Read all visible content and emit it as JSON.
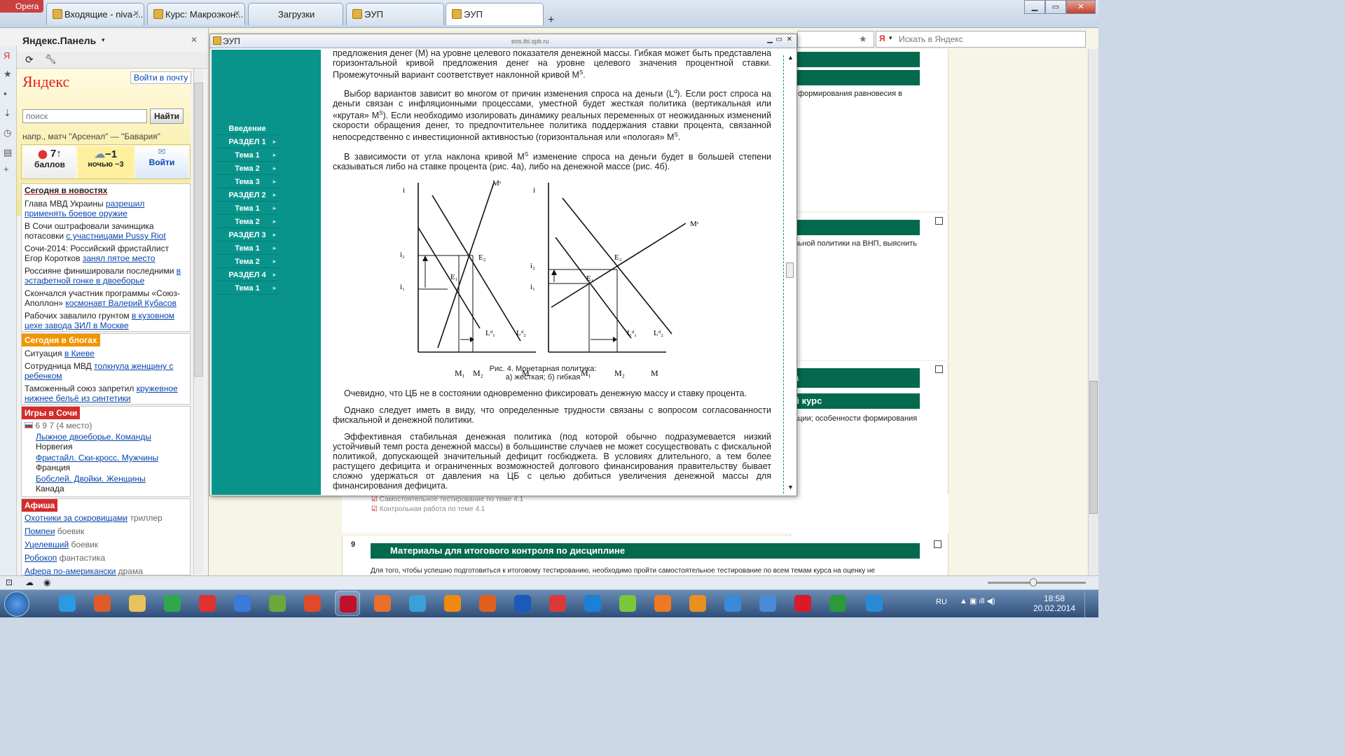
{
  "browser": {
    "app_name": "Opera",
    "tabs": [
      {
        "label": "Входящие - niva-..."
      },
      {
        "label": "Курс: Макроэкон..."
      },
      {
        "label": "Загрузки"
      },
      {
        "label": "ЭУП"
      },
      {
        "label": "ЭУП"
      }
    ],
    "new_tab": "+",
    "search_placeholder": "Искать в Яндекс"
  },
  "yandex_panel": {
    "title": "Яндекс.Панель",
    "logo": "Яндекс",
    "login": "Войти в почту",
    "search_placeholder": "поиск",
    "search_button": "Найти",
    "suggest": "напр., матч \"Арсенал\" — \"Бавария\"",
    "widgets": {
      "traffic_value": "7",
      "traffic_label": "баллов",
      "weather_value": "−1",
      "weather_label": "ночью −3",
      "mail_label": "Войти"
    },
    "news_title": "Сегодня в новостях",
    "news": [
      {
        "pre": "Глава МВД Украины ",
        "link": "разрешил применять боевое оружие"
      },
      {
        "pre": "В Сочи оштрафовали зачинщика потасовки ",
        "link": "с участницами Pussy Riot"
      },
      {
        "pre": "Сочи-2014: Российский фристайлист Егор Коротков ",
        "link": "занял пятое место"
      },
      {
        "pre": "Россияне финишировали последними ",
        "link": "в эстафетной гонке в двоеборье"
      },
      {
        "pre": "Скончался участник программы «Союз-Аполлон» ",
        "link": "космонавт Валерий Кубасов"
      },
      {
        "pre": "Рабочих завалило грунтом ",
        "link": "в кузовном цехе завода ЗИЛ в Москве"
      }
    ],
    "blogs_title": "Сегодня в блогах",
    "blogs": [
      {
        "pre": "Ситуация ",
        "link": "в Киеве"
      },
      {
        "pre": "Сотрудница МВД ",
        "link": "толкнула женщину с ребенком"
      },
      {
        "pre": "Таможенный союз запретил ",
        "link": "кружевное нижнее бельё из синтетики"
      }
    ],
    "games_title": "Игры в Сочи",
    "medals": "6  9  7  (4 место)",
    "games": [
      {
        "event": "Лыжное двоеборье. Команды",
        "country": "Норвегия"
      },
      {
        "event": "Фристайл. Ски-кросс. Мужчины",
        "country": "Франция"
      },
      {
        "event": "Бобслей. Двойки. Женщины",
        "country": "Канада"
      }
    ],
    "afisha_title": "Афиша",
    "afisha": [
      {
        "film": "Охотники за сокровищами",
        "genre": "триллер"
      },
      {
        "film": "Помпеи",
        "genre": "боевик"
      },
      {
        "film": "Уцелевший",
        "genre": "боевик"
      },
      {
        "film": "Робокоп",
        "genre": "фантастика"
      },
      {
        "film": "Афера по-американски",
        "genre": "драма"
      }
    ]
  },
  "background_page": {
    "text1": ": формирования равновесия в",
    "text2": "льной политики на ВНП, выяснить",
    "bar_a": "а",
    "bar_course": "й курс",
    "text3": "ации; особенности формирования",
    "item1": "Самостоятельное тестирование по теме 4.1",
    "item2": "Контрольная работа по теме 4.1",
    "row_num": "9",
    "final_title": "Материалы для итогового контроля по дисциплине",
    "final_text": "Для того, чтобы успешно подготовиться к итоговому тестированию, необходимо пройти самостоятельное тестирование по всем темам курса на оценку не"
  },
  "popup": {
    "title": "ЭУП",
    "url": "eos.ibi.spb.ru",
    "nav": [
      "Введение",
      "РАЗДЕЛ 1",
      "Тема 1",
      "Тема 2",
      "Тема 3",
      "РАЗДЕЛ 2",
      "Тема 1",
      "Тема 2",
      "РАЗДЕЛ 3",
      "Тема 1",
      "Тема 2",
      "РАЗДЕЛ 4",
      "Тема 1"
    ],
    "p0": "предложения денег (M) на уровне целевого показателя денежной массы. Гибкая может быть представлена горизонтальной кривой предложения денег на уровне целевого значения процентной ставки. Промежуточный вариант соответствует наклонной кривой M",
    "p1": "Выбор вариантов зависит во многом от причин изменения спроса на деньги (L",
    "p1b": "). Если рост спроса на деньги связан с инфляционными процессами, уместной будет жесткая политика (вертикальная или «крутая» M",
    "p1c": "). Если необходимо изолировать динамику реальных переменных от неожиданных изменений скорости обращения денег, то предпочтительнее политика поддержания ставки процента, связанной непосредственно с инвестиционной активностью (горизонтальная или «пологая» M",
    "p2": "В зависимости от угла наклона кривой M",
    "p2b": " изменение спроса на деньги будет в большей степени сказываться либо на ставке процента (рис. 4а), либо на денежной массе (рис. 4б).",
    "fig_caption1": "Рис. 4. Монетарная политика:",
    "fig_caption2": "а) жесткая; б) гибкая",
    "p3": "Очевидно, что ЦБ не в состоянии одновременно фиксировать денежную массу и ставку процента.",
    "p4": "Однако следует иметь в виду, что определенные трудности связаны с вопросом согласованности фискальной и денежной политики.",
    "p5": "Эффективная стабильная денежная политика (под которой обычно подразумевается низкий устойчивый темп роста денежной массы) в большинстве случаев не может сосуществовать с фискальной политикой, допускающей значительный дефицит госбюджета. В условиях длительного, а тем более растущего дефицита и ограниченных возможностей долгового финансирования правительству бывает сложно удержаться от давления на ЦБ с целью добиться увеличения денежной массы для финансирования дефицита.",
    "graph_labels": {
      "i": "i",
      "Ms": "Mˢ",
      "i1": "i₁",
      "i2": "i₂",
      "E1": "E₁",
      "E2": "E₂",
      "Ld1": "Lᵈ₁",
      "Ld2": "Lᵈ₂",
      "M1": "M₁",
      "M2": "M₂",
      "M": "M"
    }
  },
  "taskbar": {
    "lang": "RU",
    "time": "18:58",
    "date": "20.02.2014"
  }
}
